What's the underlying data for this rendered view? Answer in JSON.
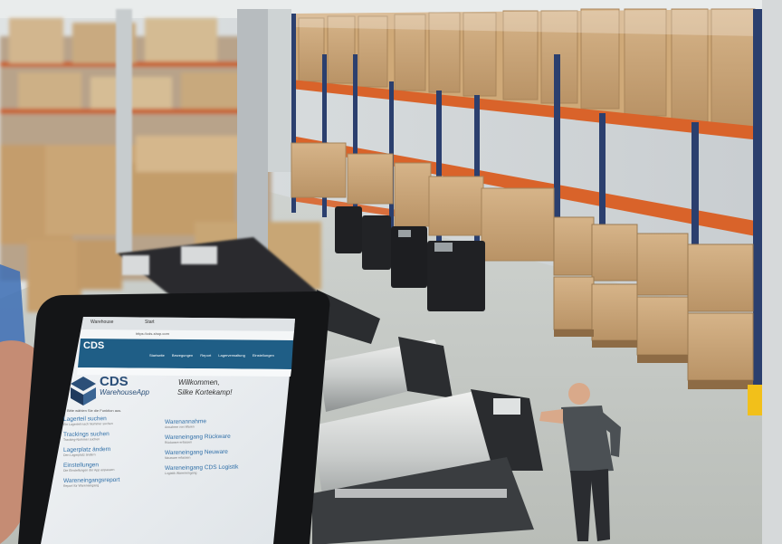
{
  "browser": {
    "tab_label": "Warehouse",
    "tab2_label": "Start",
    "url": "https://cds-shop.com"
  },
  "app_header": {
    "brand": "CDS",
    "nav": [
      "Startseite",
      "Bewegungen",
      "Report",
      "Lagerverwaltung",
      "Einstellungen"
    ]
  },
  "logo": {
    "name": "CDS",
    "sub": "WarehouseApp"
  },
  "welcome": {
    "line1": "Willkommen,",
    "line2": "Silke Kortekamp!"
  },
  "intro": "Bitte wählen Sie die Funktion aus.",
  "menu_left": [
    {
      "title": "Lagerteil suchen",
      "desc": "Ein Lagerteil nach Nummer suchen"
    },
    {
      "title": "Trackings suchen",
      "desc": "Tracking-Nummer suchen"
    },
    {
      "title": "Lagerplatz ändern",
      "desc": "Den Lagerplatz ändern"
    },
    {
      "title": "Einstellungen",
      "desc": "Die Einstellungen der App anpassen"
    },
    {
      "title": "Wareneingangsreport",
      "desc": "Report für Wareneingang"
    }
  ],
  "menu_right": [
    {
      "title": "Warenannahme",
      "desc": "Annahme von Waren"
    },
    {
      "title": "Wareneingang Rückware",
      "desc": "Rückware erfassen"
    },
    {
      "title": "Wareneingang Neuware",
      "desc": "Neuware erfassen"
    },
    {
      "title": "Wareneingang CDS Logistik",
      "desc": "Logistik Wareneingang"
    }
  ],
  "colors": {
    "header_blue": "#1f5e86",
    "link_blue": "#2f6fa8",
    "rack_orange": "#d9632a",
    "rack_blue": "#2b3f6e",
    "box_tan": "#c9a473"
  }
}
